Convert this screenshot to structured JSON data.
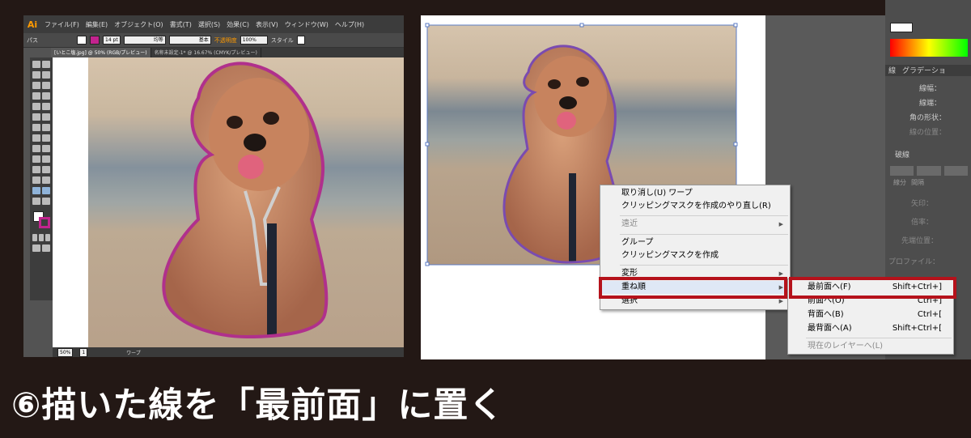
{
  "left_window": {
    "app_logo": "Ai",
    "menus": [
      "ファイル(F)",
      "編集(E)",
      "オブジェクト(O)",
      "書式(T)",
      "選択(S)",
      "効果(C)",
      "表示(V)",
      "ウィンドウ(W)",
      "ヘルプ(H)"
    ],
    "control_bar": {
      "selection_label": "パス",
      "stroke_weight": "14 pt",
      "profile_label": "均等",
      "brush_label": "基本",
      "opacity_label": "不透明度",
      "opacity_value": "100%",
      "style_label": "スタイル"
    },
    "doc_tabs": [
      "[いとこ塩.jpg] @ 50% (RGB/プレビュー)",
      "名称未設定-1* @ 16.67% (CMYK/プレビュー)"
    ],
    "status_bar": {
      "zoom": "50%",
      "page": "1",
      "tool": "ワープ"
    }
  },
  "right_panel": {
    "stroke_tab": "線",
    "gradient_tab": "グラデーショ",
    "rows": [
      "線幅：",
      "線端：",
      "角の形状：",
      "線の位置："
    ],
    "dash_label": "破線",
    "dash_cols": [
      "線分",
      "間隔"
    ],
    "rows2": [
      "矢印：",
      "倍率：",
      "先端位置："
    ],
    "profile_label": "プロファイル："
  },
  "context_menu": {
    "items": [
      {
        "label": "取り消し(U) ワープ",
        "disabled": false,
        "arrow": false
      },
      {
        "label": "クリッピングマスクを作成のやり直し(R)",
        "disabled": false,
        "arrow": false
      },
      {
        "label": "遠近",
        "disabled": true,
        "arrow": true
      },
      {
        "label": "グループ",
        "disabled": false,
        "arrow": false
      },
      {
        "label": "クリッピングマスクを作成",
        "disabled": false,
        "arrow": false
      },
      {
        "label": "変形",
        "disabled": false,
        "arrow": true
      },
      {
        "label": "重ね順",
        "disabled": false,
        "arrow": true
      },
      {
        "label": "選択",
        "disabled": false,
        "arrow": true
      }
    ]
  },
  "submenu": {
    "items": [
      {
        "label": "最前面へ(F)",
        "shortcut": "Shift+Ctrl+]",
        "disabled": false
      },
      {
        "label": "前面へ(O)",
        "shortcut": "Ctrl+]",
        "disabled": false
      },
      {
        "label": "背面へ(B)",
        "shortcut": "Ctrl+[",
        "disabled": false
      },
      {
        "label": "最背面へ(A)",
        "shortcut": "Shift+Ctrl+[",
        "disabled": false
      },
      {
        "label": "現在のレイヤーへ(L)",
        "shortcut": "",
        "disabled": true
      }
    ]
  },
  "caption": "⑥描いた線を「最前面」に置く",
  "colors": {
    "background": "#231815",
    "highlight_red": "#b5121b",
    "path_stroke": "#b0308c"
  }
}
